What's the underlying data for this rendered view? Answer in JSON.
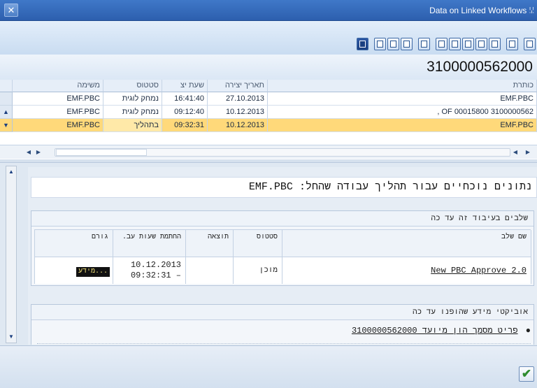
{
  "window": {
    "title": "Data on Linked Workflows ꗹ",
    "close_glyph": "✕"
  },
  "toolbar": {
    "icons": [
      "info-icon",
      "table-view-icon",
      "export-icon",
      "print-icon",
      "filter-icon",
      "sort-ascending-icon",
      "sort-descending-icon",
      "find-icon",
      "save-layout-icon",
      "choose-layout-icon",
      "change-layout-icon",
      "detail-icon"
    ]
  },
  "header": {
    "document_number": "3100000562000"
  },
  "table": {
    "columns": {
      "title": "כותרת",
      "created_date": "תאריך יצירה",
      "created_time": "שעת יצ",
      "status": "סטטוס",
      "task": "משימה"
    },
    "rows": [
      {
        "title": "EMF.PBC",
        "created_date": "27.10.2013",
        "created_time": "16:41:40",
        "status": "נמחק לוגית",
        "task": "EMF.PBC"
      },
      {
        "title": ", OF 00015800 3100000562",
        "created_date": "10.12.2013",
        "created_time": "09:12:40",
        "status": "נמחק לוגית",
        "task": "EMF.PBC"
      },
      {
        "title": "EMF.PBC",
        "created_date": "10.12.2013",
        "created_time": "09:32:31",
        "status": "בתהליך",
        "task": "EMF.PBC"
      }
    ],
    "selected_row": 2
  },
  "detail": {
    "heading": "נתונים נוכחיים עבור תהליך עבודה שהחל: EMF.PBC",
    "steps_section": {
      "title": "שלבים בעיבוד זה עד כה",
      "columns": {
        "step_name": "שם שלב",
        "status": "סטטוס",
        "result": "תוצאה",
        "wait_time": "החתמת שעות עב.",
        "agent": "גורם"
      },
      "rows": [
        {
          "step_name": "New PBC Approve 2.0",
          "status": "מוכן",
          "result": "",
          "wait_date": "10.12.2013",
          "wait_time": "09:32:31 –",
          "agent": "מידע..."
        }
      ]
    },
    "objects_section": {
      "title": "אוביקטי מידע שהופנו עד כה",
      "items": [
        {
          "label": "פריט מסמך הון מיועד 3100000562000"
        }
      ]
    }
  },
  "footer": {
    "confirm_glyph": "✔"
  }
}
